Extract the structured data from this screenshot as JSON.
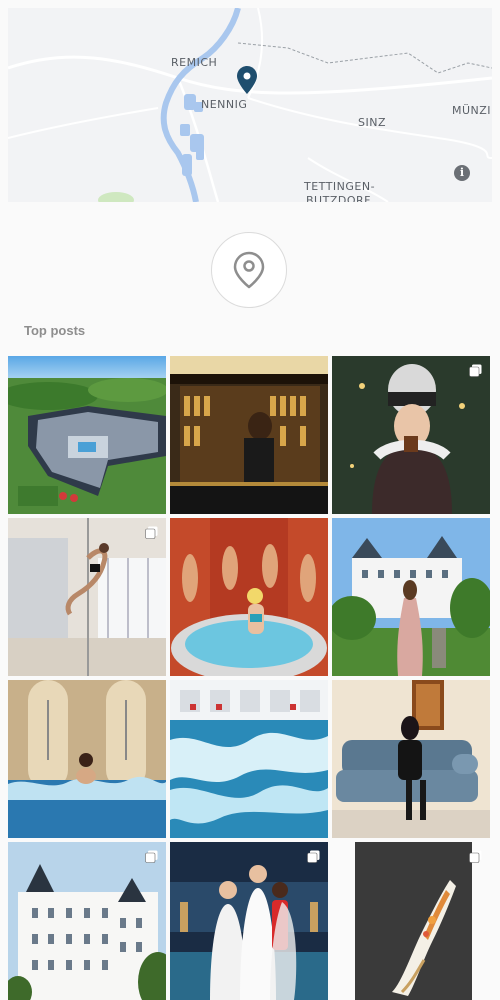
{
  "map": {
    "labels": [
      "REMICH",
      "NENNIG",
      "SINZ",
      "TETTINGEN-",
      "BUTZDORF",
      "MÜNZI"
    ],
    "info_glyph": "i",
    "pin_color": "#1f4e6e",
    "river_color": "#a9c7ee"
  },
  "location": {
    "icon": "location-pin-icon",
    "section_title": "Top posts"
  },
  "posts": [
    {
      "alt": "Aerial view of hotel resort",
      "multi": false
    },
    {
      "alt": "Bartender at bar",
      "multi": false
    },
    {
      "alt": "Woman in winter hat with drink",
      "multi": true
    },
    {
      "alt": "Pole dance studio",
      "multi": true
    },
    {
      "alt": "Woman at spa whirlpool",
      "multi": false
    },
    {
      "alt": "Woman in front of castle",
      "multi": false
    },
    {
      "alt": "Woman in spa pool",
      "multi": false
    },
    {
      "alt": "Bubbling pool water",
      "multi": false
    },
    {
      "alt": "Woman on blue chesterfield sofa",
      "multi": false
    },
    {
      "alt": "White castle with towers",
      "multi": true
    },
    {
      "alt": "Group in bathrobes at spa",
      "multi": true
    },
    {
      "alt": "Plated dessert",
      "multi": true
    }
  ]
}
